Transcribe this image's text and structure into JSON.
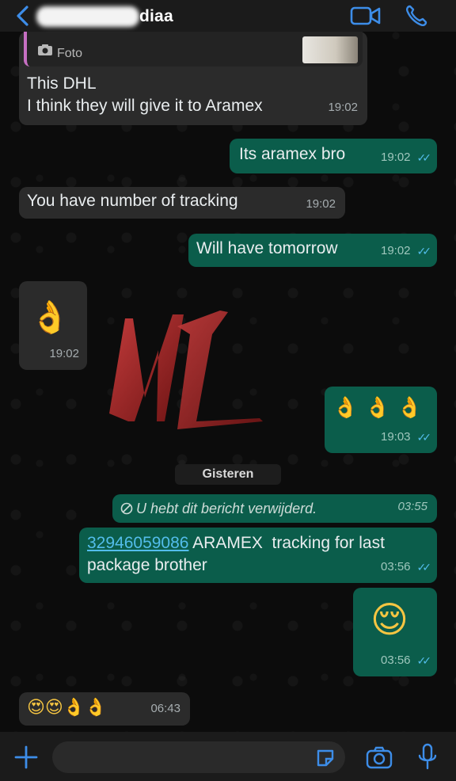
{
  "header": {
    "contact_name": "diaa",
    "back_icon": "chevron-left-icon",
    "video_icon": "video-camera-icon",
    "call_icon": "phone-icon"
  },
  "messages": [
    {
      "id": "m1",
      "dir": "in",
      "quote_label": "Foto",
      "lines": [
        "This DHL",
        "I think they will give it to Aramex"
      ],
      "time": "19:02"
    },
    {
      "id": "m2",
      "dir": "out",
      "text": "Its aramex bro",
      "time": "19:02"
    },
    {
      "id": "m3",
      "dir": "in",
      "text": "You have number of tracking",
      "time": "19:02"
    },
    {
      "id": "m4",
      "dir": "out",
      "text": "Will have tomorrow",
      "time": "19:02"
    },
    {
      "id": "m5",
      "dir": "in",
      "emoji": "👌",
      "time": "19:02"
    },
    {
      "id": "m6",
      "dir": "out",
      "emoji": "👌 👌 👌",
      "time": "19:03"
    },
    {
      "id": "m7",
      "dir": "out",
      "deleted_text": "U hebt dit bericht verwijderd.",
      "time": "03:55"
    },
    {
      "id": "m8",
      "dir": "out",
      "link_text": "32946059086",
      "text_after": " ARAMEX  tracking for last",
      "text_line2": "package brother",
      "time": "03:56"
    },
    {
      "id": "m9",
      "dir": "out",
      "emoji": "😌",
      "time": "03:56"
    },
    {
      "id": "m10",
      "dir": "in",
      "emoji": "😍😍👌👌",
      "time": "06:43"
    }
  ],
  "date_divider": "Gisteren",
  "watermark": "NL",
  "colors": {
    "incoming_bubble": "#2b2b2b",
    "outgoing_bubble": "#0b5d4b",
    "read_ticks": "#53bdeb",
    "accent": "#3d8de8"
  },
  "footer": {
    "input_placeholder": "",
    "plus_icon": "plus-icon",
    "sticker_icon": "sticker-icon",
    "camera_icon": "camera-icon",
    "mic_icon": "microphone-icon"
  }
}
